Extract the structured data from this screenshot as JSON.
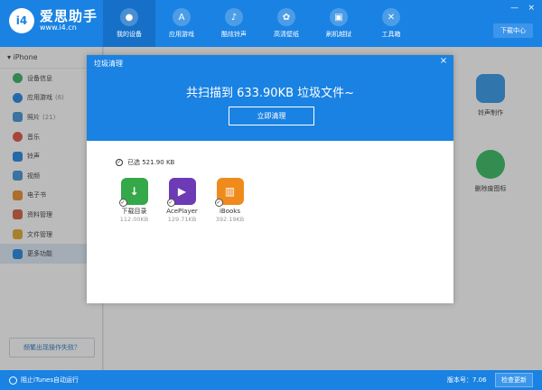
{
  "app": {
    "logo_badge": "i4",
    "name": "爱思助手",
    "url": "www.i4.cn"
  },
  "nav": [
    {
      "label": "我的设备",
      "icon": "apple-icon",
      "glyph": ""
    },
    {
      "label": "应用游戏",
      "icon": "app-store-icon",
      "glyph": "A"
    },
    {
      "label": "酷炫铃声",
      "icon": "bell-icon",
      "glyph": "♪"
    },
    {
      "label": "高清壁纸",
      "icon": "flower-icon",
      "glyph": "✿"
    },
    {
      "label": "刷机越狱",
      "icon": "box-icon",
      "glyph": "▣"
    },
    {
      "label": "工具箱",
      "icon": "tools-icon",
      "glyph": "✕"
    }
  ],
  "window": {
    "minimize": "—",
    "close": "×"
  },
  "download_center": "下载中心",
  "sidebar": {
    "device": "iPhone",
    "items": [
      {
        "label": "设备信息",
        "count": "",
        "color": "#2eaf5a"
      },
      {
        "label": "应用游戏",
        "count": "(6)",
        "color": "#1a82e2"
      },
      {
        "label": "照片",
        "count": "(21)",
        "color": "#3b8fd6"
      },
      {
        "label": "音乐",
        "count": "",
        "color": "#e24a3b"
      },
      {
        "label": "铃声",
        "count": "",
        "color": "#1a82e2"
      },
      {
        "label": "视频",
        "count": "",
        "color": "#3b8fd6"
      },
      {
        "label": "电子书",
        "count": "",
        "color": "#e98b25"
      },
      {
        "label": "资料管理",
        "count": "",
        "color": "#d25a3a"
      },
      {
        "label": "文件管理",
        "count": "",
        "color": "#e0a625"
      },
      {
        "label": "更多功能",
        "count": "",
        "color": "#1a82e2"
      }
    ],
    "fail_link": "频繁出现操作失败？"
  },
  "content": {
    "tools": [
      {
        "label": "铃声制作",
        "color": "#2a94e8"
      },
      {
        "label": "删除废图标",
        "color": "#2eb85c"
      }
    ]
  },
  "dialog": {
    "title": "垃圾清理",
    "close": "×",
    "scan_text": "共扫描到 633.90KB 垃圾文件~",
    "clean_button": "立即清理",
    "selected": "已选 521.90 KB",
    "apps": [
      {
        "name": "下载目录",
        "size": "112.00KB",
        "color": "#35a84a",
        "glyph": "↓"
      },
      {
        "name": "AcePlayer",
        "size": "129.71KB",
        "color": "#6d3bb5",
        "glyph": "▶"
      },
      {
        "name": "iBooks",
        "size": "392.19KB",
        "color": "#ef8a1c",
        "glyph": "▥"
      }
    ]
  },
  "statusbar": {
    "itunes": "阻止iTunes自动运行",
    "version": "版本号：7.06",
    "update": "检查更新"
  }
}
